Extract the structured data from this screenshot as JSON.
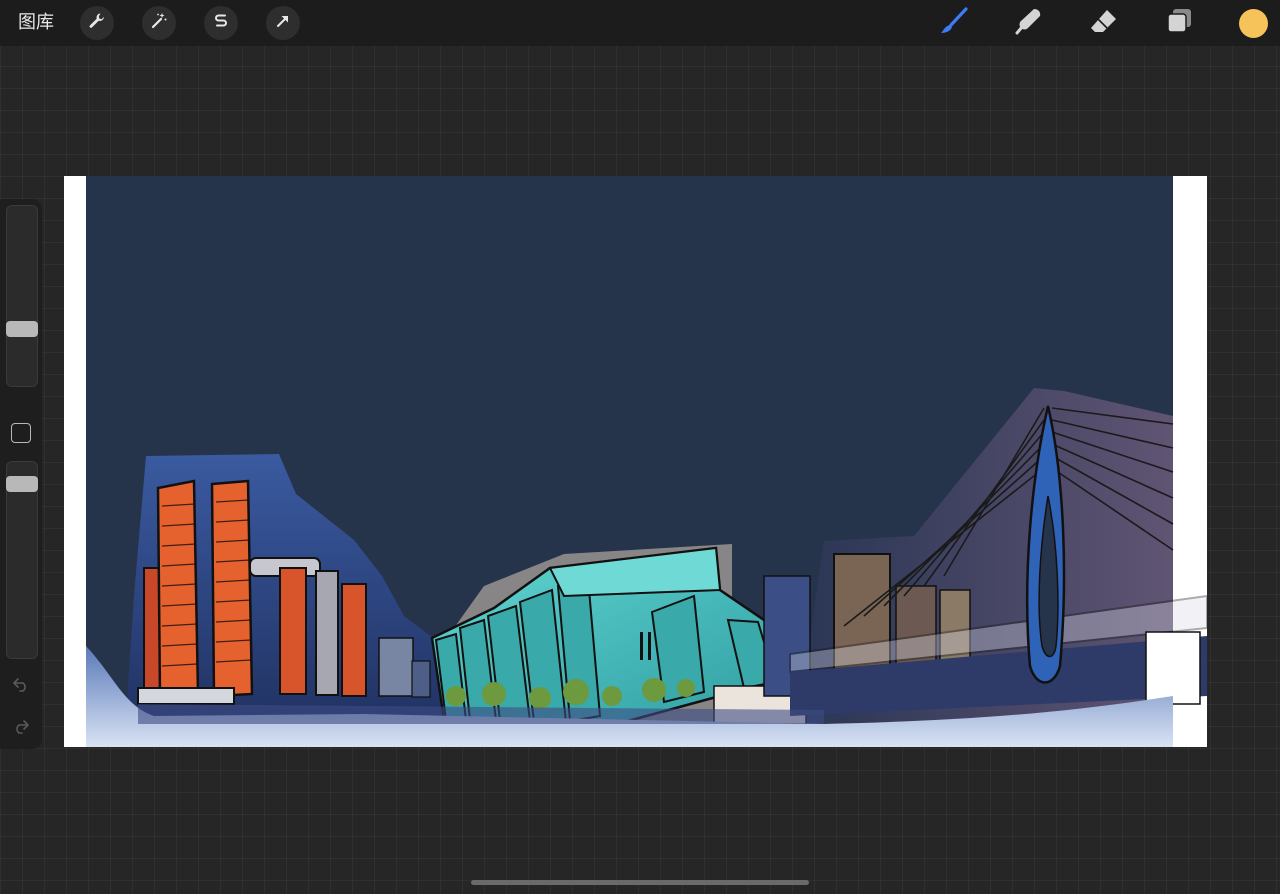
{
  "toolbar": {
    "gallery_label": "图库",
    "left_tools": [
      {
        "name": "actions-wrench-icon"
      },
      {
        "name": "adjustments-magic-wand-icon"
      },
      {
        "name": "selection-s-icon"
      },
      {
        "name": "transform-arrow-icon"
      }
    ],
    "right_tools": [
      {
        "name": "brush-icon",
        "active": true
      },
      {
        "name": "smudge-icon"
      },
      {
        "name": "eraser-icon"
      },
      {
        "name": "layers-icon"
      }
    ],
    "current_color": "#f6c25a"
  },
  "sidebar": {
    "brush_size_level": 0.7,
    "opacity_level": 0.92
  },
  "colors": {
    "app_bg": "#262626",
    "toolbar_bg": "#1c1c1c",
    "active_tool": "#3e7bf6",
    "sky": "#26344b",
    "tower_orange": "#e5622f",
    "museum_teal": "#4fc6c4"
  }
}
